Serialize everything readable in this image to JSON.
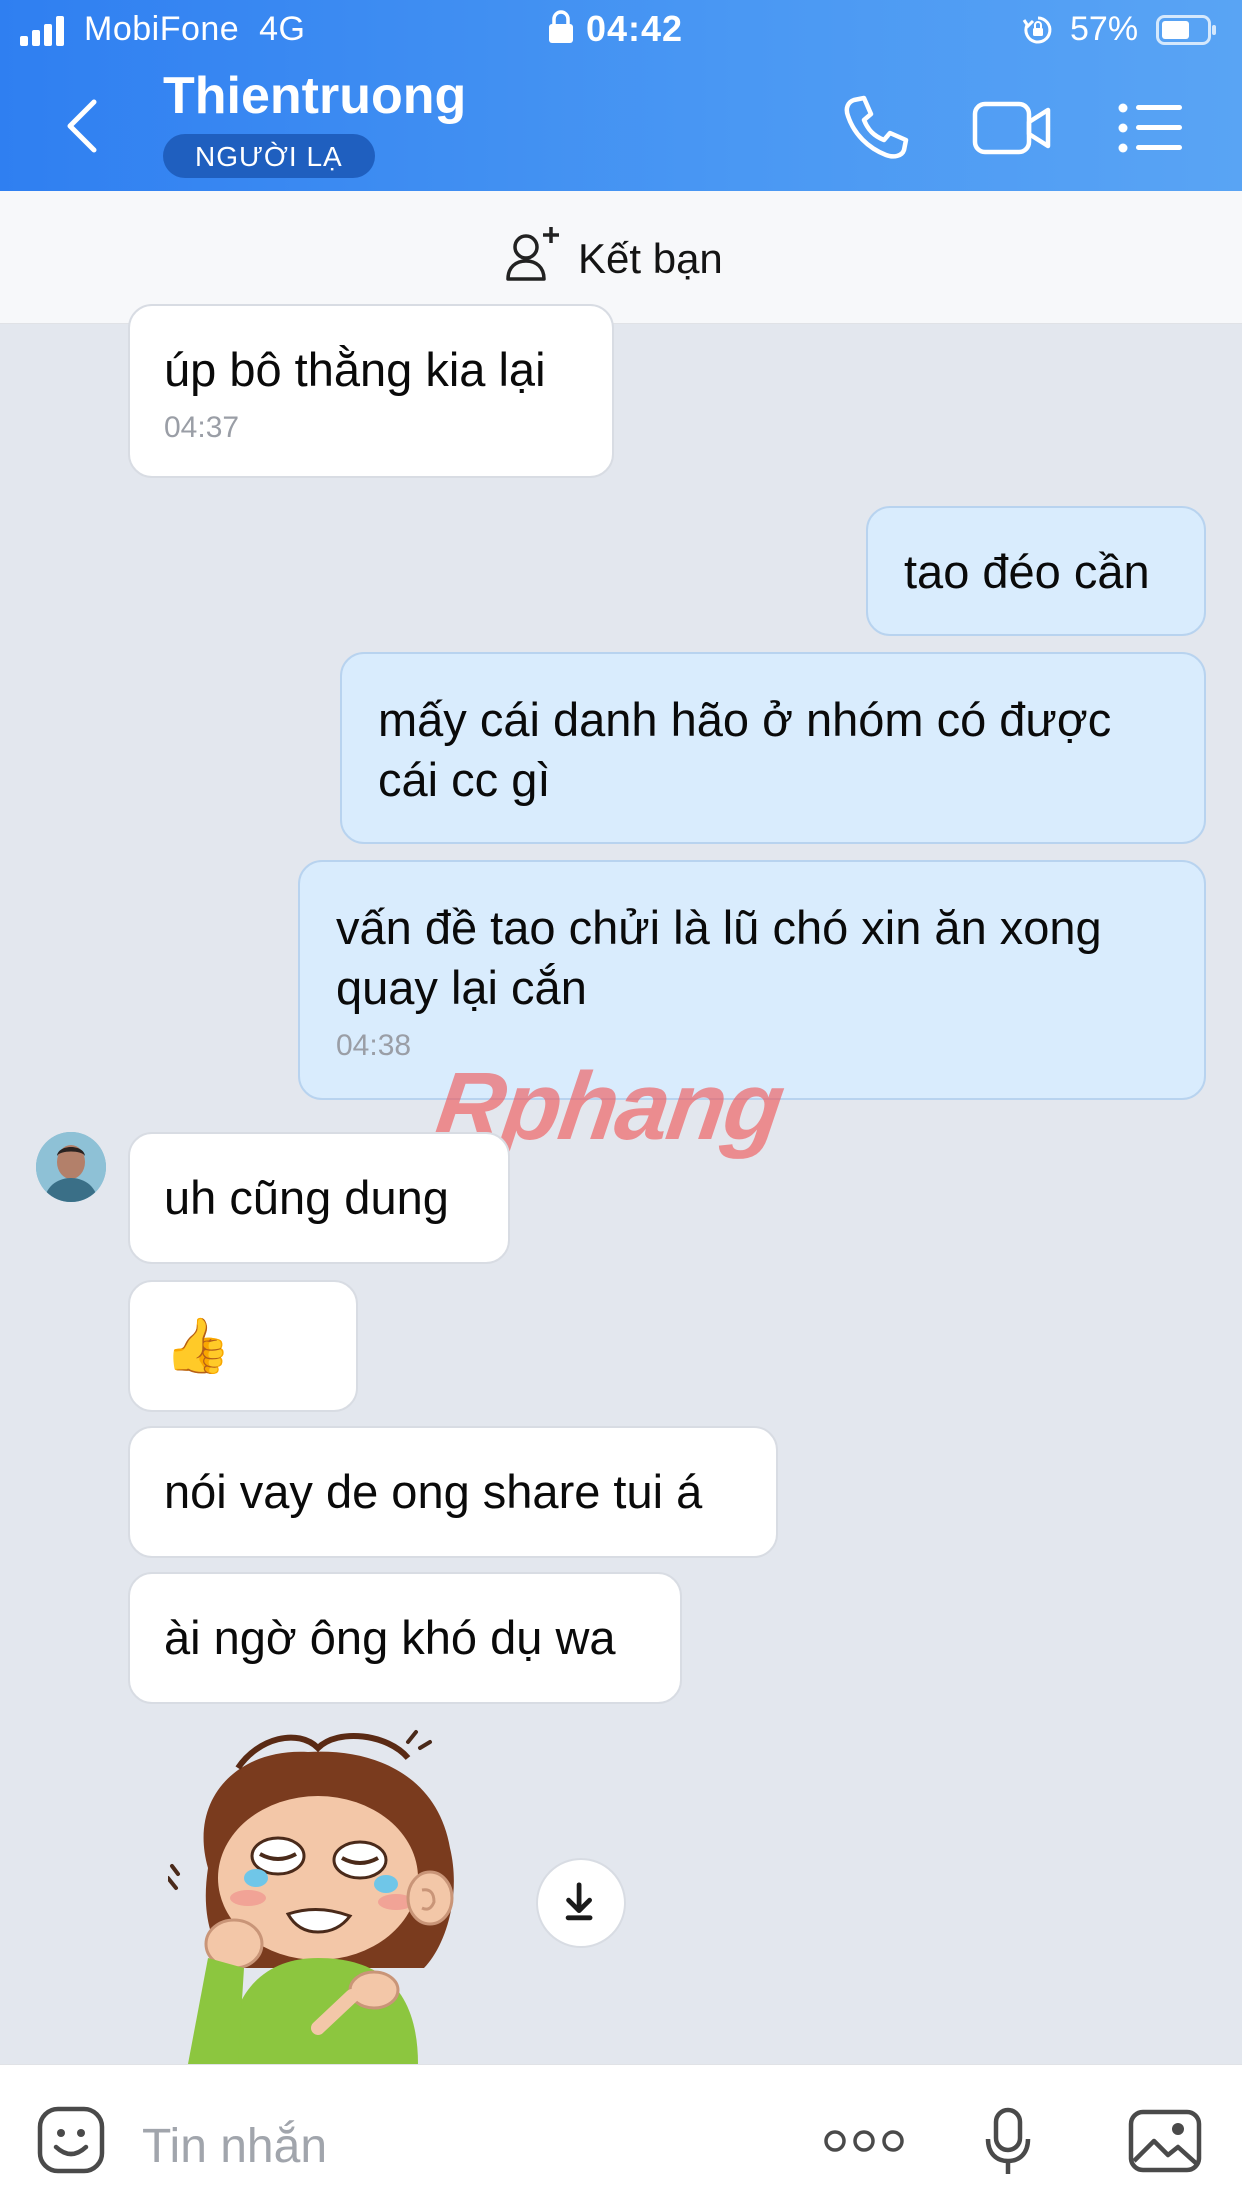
{
  "status_bar": {
    "carrier": "MobiFone",
    "network": "4G",
    "time": "04:42",
    "battery": "57%"
  },
  "header": {
    "title": "Thientruong",
    "badge": "NGƯỜI LẠ"
  },
  "add_friend": {
    "label": "Kết bạn"
  },
  "messages": [
    {
      "side": "in",
      "text": "úp bô thằng kia lại",
      "time": "04:37"
    },
    {
      "side": "out",
      "text": "tao đéo cần",
      "time": ""
    },
    {
      "side": "out",
      "text": "mấy cái danh hão ở nhóm có được cái cc gì",
      "time": ""
    },
    {
      "side": "out",
      "text": "vấn đề tao chửi là lũ chó xin ăn xong quay lại cắn",
      "time": "04:38"
    },
    {
      "side": "in",
      "text": "uh cũng dung",
      "time": ""
    },
    {
      "side": "in",
      "text": "👍",
      "time": ""
    },
    {
      "side": "in",
      "text": "nói vay de ong share tui á",
      "time": ""
    },
    {
      "side": "in",
      "text": "ài ngờ ông khó dụ wa",
      "time": ""
    }
  ],
  "watermark": "Rphang",
  "input": {
    "placeholder": "Tin nhắn"
  },
  "icons": [
    "back-chevron-icon",
    "phone-icon",
    "video-call-icon",
    "menu-icon",
    "add-friend-icon",
    "emoji-icon",
    "more-dots-icon",
    "microphone-icon",
    "gallery-icon",
    "download-icon"
  ],
  "colors": {
    "header": "#3a8cf2",
    "outgoing_bubble": "#d9ecfd",
    "incoming_bubble": "#ffffff",
    "chat_bg": "#e3e7ee"
  }
}
